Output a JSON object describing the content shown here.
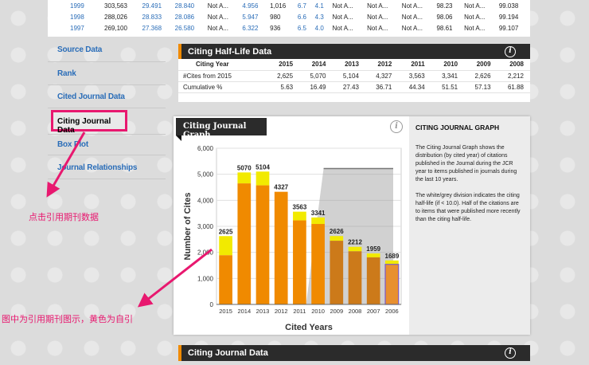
{
  "top_table": {
    "rows": [
      [
        "1999",
        "303,563",
        "29.491",
        "28.840",
        "Not A...",
        "4.956",
        "1,016",
        "6.7",
        "4.1",
        "Not A...",
        "Not A...",
        "Not A...",
        "98.23",
        "Not A...",
        "99.038"
      ],
      [
        "1998",
        "288,026",
        "28.833",
        "28.086",
        "Not A...",
        "5.947",
        "980",
        "6.6",
        "4.3",
        "Not A...",
        "Not A...",
        "Not A...",
        "98.06",
        "Not A...",
        "99.194"
      ],
      [
        "1997",
        "269,100",
        "27.368",
        "26.580",
        "Not A...",
        "6.322",
        "936",
        "6.5",
        "4.0",
        "Not A...",
        "Not A...",
        "Not A...",
        "98.61",
        "Not A...",
        "99.107"
      ]
    ]
  },
  "sidebar": {
    "items": [
      "Source Data",
      "Rank",
      "Cited Journal Data",
      "Citing Journal Data",
      "Box Plot",
      "Journal Relationships"
    ]
  },
  "half_life": {
    "title": "Citing Half-Life Data",
    "headers": [
      "Citing Year",
      "2015",
      "2014",
      "2013",
      "2012",
      "2011",
      "2010",
      "2009",
      "2008"
    ],
    "rows": [
      [
        "#Cites from 2015",
        "2,625",
        "5,070",
        "5,104",
        "4,327",
        "3,563",
        "3,341",
        "2,626",
        "2,212"
      ],
      [
        "Cumulative %",
        "5.63",
        "16.49",
        "27.43",
        "36.71",
        "44.34",
        "51.51",
        "57.13",
        "61.88"
      ]
    ]
  },
  "graph": {
    "tab_title": "Citing Journal Graph",
    "info": "i"
  },
  "description": {
    "title": "CITING JOURNAL GRAPH",
    "p1": "The Citing Journal Graph shows the distribution (by cited year) of citations published in the Journal during the JCR year to items published in journals during the last 10 years.",
    "p2": "The white/grey division indicates the citing half-life (if < 10.0). Half of the citations are to items that were published more recently than the citing half-life."
  },
  "chart_data": {
    "type": "bar",
    "categories": [
      "2015",
      "2014",
      "2013",
      "2012",
      "2011",
      "2010",
      "2009",
      "2008",
      "2007",
      "2006"
    ],
    "values": [
      2625,
      5070,
      5104,
      4327,
      3563,
      3341,
      2626,
      2212,
      1959,
      1689
    ],
    "self_cites": [
      735,
      420,
      530,
      0,
      335,
      250,
      180,
      170,
      150,
      150
    ],
    "ylabel": "Number of Cites",
    "xlabel": "Cited Years",
    "ylim": [
      0,
      6000
    ],
    "yticks": [
      "0",
      "1,000",
      "2,000",
      "3,000",
      "4,000",
      "5,000",
      "6,000"
    ],
    "half_life": 5.8,
    "colors": {
      "cites": "#f08a00",
      "self": "#f2ea00",
      "after_half": "#cc7a1a",
      "last": "#e89030"
    }
  },
  "bottom": {
    "title": "Citing Journal Data"
  },
  "annotations": {
    "click_note": "点击引用期刊数据",
    "graph_note": "图中为引用期刊图示，黄色为自引"
  },
  "info_icon": "i"
}
